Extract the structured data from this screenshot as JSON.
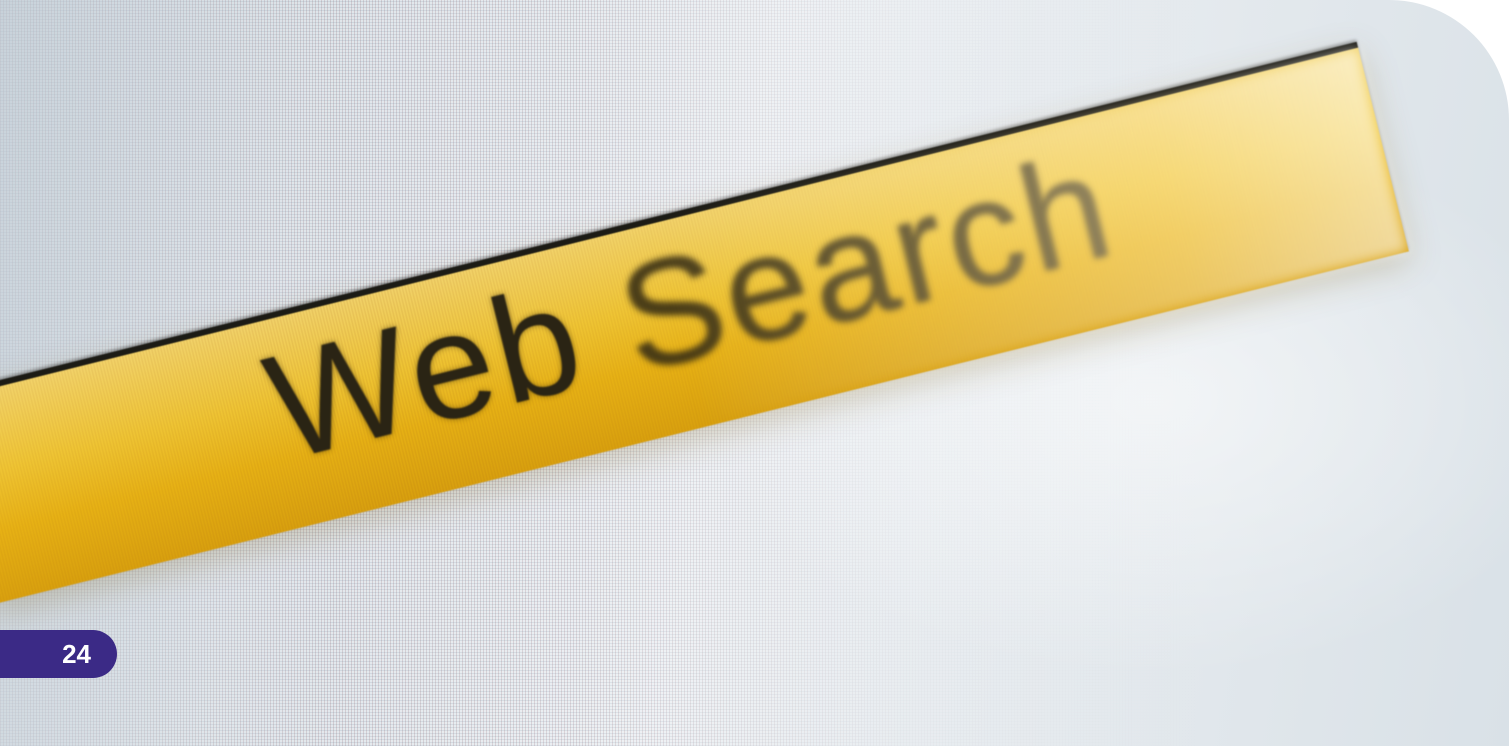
{
  "photo": {
    "search_bar_text_first": "Web",
    "search_bar_text_second": "Search",
    "colors": {
      "search_bar": "#f0c634",
      "background": "#e6ebef",
      "page_tab": "#3b2a86"
    }
  },
  "page": {
    "number": "24"
  }
}
